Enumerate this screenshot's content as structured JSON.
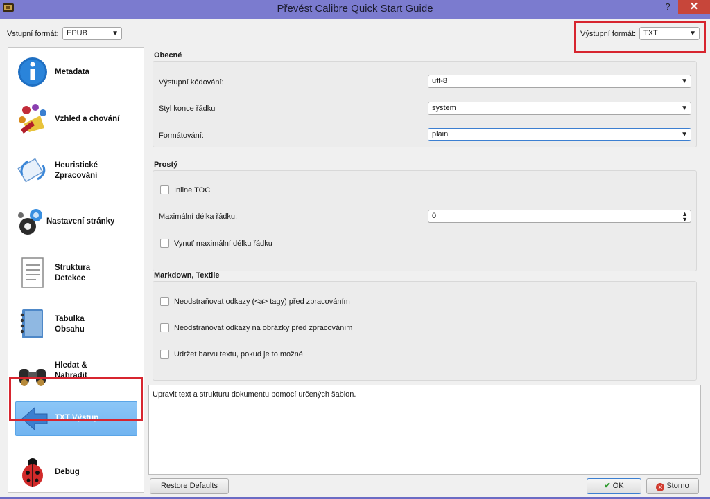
{
  "window": {
    "title": "Převést Calibre Quick Start Guide",
    "help_glyph": "?",
    "close_glyph": "✕"
  },
  "input_format": {
    "label": "Vstupní formát:",
    "value": "EPUB"
  },
  "output_format": {
    "label": "Výstupní formát:",
    "value": "TXT"
  },
  "sidebar": {
    "items": [
      {
        "label": "Metadata",
        "icon": "info-icon"
      },
      {
        "label": "Vzhled a chování",
        "icon": "palette-icon"
      },
      {
        "label": "Heuristické Zpracování",
        "icon": "heuristic-icon"
      },
      {
        "label": "Nastavení stránky",
        "icon": "gears-icon"
      },
      {
        "label": "Struktura Detekce",
        "icon": "document-icon"
      },
      {
        "label": "Tabulka Obsahu",
        "icon": "notebook-icon"
      },
      {
        "label": "Hledat & Nahradit",
        "icon": "binoculars-icon"
      },
      {
        "label": "TXT Výstup",
        "icon": "arrow-left-icon"
      },
      {
        "label": "Debug",
        "icon": "ladybug-icon"
      }
    ]
  },
  "general": {
    "title": "Obecné",
    "encoding": {
      "label": "Výstupní kódování:",
      "value": "utf-8"
    },
    "line_ending": {
      "label": "Styl konce řádku",
      "value": "system"
    },
    "formatting": {
      "label": "Formátování:",
      "value": "plain"
    }
  },
  "plain": {
    "title": "Prostý",
    "inline_toc": {
      "label": "Inline TOC",
      "checked": false
    },
    "max_line": {
      "label": "Maximální délka řádku:",
      "value": "0"
    },
    "force_max": {
      "label": "Vynuť maximální délku řádku",
      "checked": false
    }
  },
  "markdown": {
    "title": "Markdown, Textile",
    "keep_links": {
      "label": "Neodstraňovat odkazy (<a> tagy) před zpracováním",
      "checked": false
    },
    "keep_image_refs": {
      "label": "Neodstraňovat odkazy na obrázky před zpracováním",
      "checked": false
    },
    "keep_color": {
      "label": "Udržet barvu textu, pokud je to možné",
      "checked": false
    }
  },
  "description": "Upravit text a strukturu dokumentu pomocí určených šablon.",
  "buttons": {
    "restore": "Restore Defaults",
    "ok": "OK",
    "cancel": "Storno"
  },
  "colors": {
    "highlight_red": "#d7252f",
    "titlebar": "#7b7bcf",
    "selection_blue": "#71b4f0"
  }
}
